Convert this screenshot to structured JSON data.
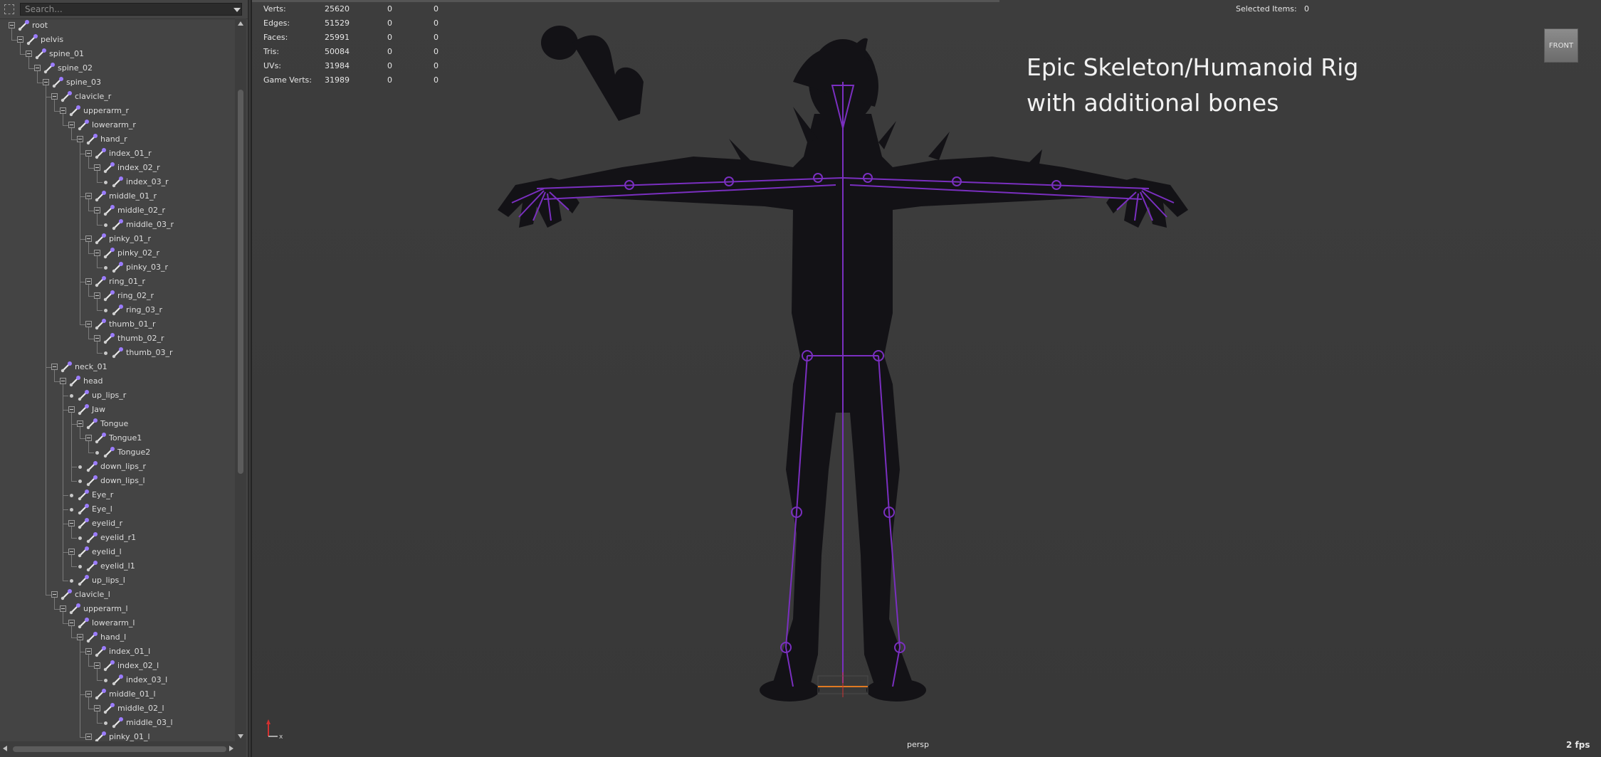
{
  "outliner": {
    "search_placeholder": "Search...",
    "nodes": [
      {
        "label": "root",
        "depth": 0,
        "children": true
      },
      {
        "label": "pelvis",
        "depth": 1,
        "children": true
      },
      {
        "label": "spine_01",
        "depth": 2,
        "children": true
      },
      {
        "label": "spine_02",
        "depth": 3,
        "children": true
      },
      {
        "label": "spine_03",
        "depth": 4,
        "children": true
      },
      {
        "label": "clavicle_r",
        "depth": 5,
        "children": true
      },
      {
        "label": "upperarm_r",
        "depth": 6,
        "children": true
      },
      {
        "label": "lowerarm_r",
        "depth": 7,
        "children": true
      },
      {
        "label": "hand_r",
        "depth": 8,
        "children": true
      },
      {
        "label": "index_01_r",
        "depth": 9,
        "children": true
      },
      {
        "label": "index_02_r",
        "depth": 10,
        "children": true
      },
      {
        "label": "index_03_r",
        "depth": 11,
        "children": false
      },
      {
        "label": "middle_01_r",
        "depth": 9,
        "children": true
      },
      {
        "label": "middle_02_r",
        "depth": 10,
        "children": true
      },
      {
        "label": "middle_03_r",
        "depth": 11,
        "children": false
      },
      {
        "label": "pinky_01_r",
        "depth": 9,
        "children": true
      },
      {
        "label": "pinky_02_r",
        "depth": 10,
        "children": true
      },
      {
        "label": "pinky_03_r",
        "depth": 11,
        "children": false
      },
      {
        "label": "ring_01_r",
        "depth": 9,
        "children": true
      },
      {
        "label": "ring_02_r",
        "depth": 10,
        "children": true
      },
      {
        "label": "ring_03_r",
        "depth": 11,
        "children": false
      },
      {
        "label": "thumb_01_r",
        "depth": 9,
        "children": true
      },
      {
        "label": "thumb_02_r",
        "depth": 10,
        "children": true
      },
      {
        "label": "thumb_03_r",
        "depth": 11,
        "children": false
      },
      {
        "label": "neck_01",
        "depth": 5,
        "children": true
      },
      {
        "label": "head",
        "depth": 6,
        "children": true
      },
      {
        "label": "up_lips_r",
        "depth": 7,
        "children": false
      },
      {
        "label": "Jaw",
        "depth": 7,
        "children": true
      },
      {
        "label": "Tongue",
        "depth": 8,
        "children": true
      },
      {
        "label": "Tongue1",
        "depth": 9,
        "children": true
      },
      {
        "label": "Tongue2",
        "depth": 10,
        "children": false
      },
      {
        "label": "down_lips_r",
        "depth": 8,
        "children": false
      },
      {
        "label": "down_lips_l",
        "depth": 8,
        "children": false
      },
      {
        "label": "Eye_r",
        "depth": 7,
        "children": false
      },
      {
        "label": "Eye_l",
        "depth": 7,
        "children": false
      },
      {
        "label": "eyelid_r",
        "depth": 7,
        "children": true
      },
      {
        "label": "eyelid_r1",
        "depth": 8,
        "children": false
      },
      {
        "label": "eyelid_l",
        "depth": 7,
        "children": true
      },
      {
        "label": "eyelid_l1",
        "depth": 8,
        "children": false
      },
      {
        "label": "up_lips_l",
        "depth": 7,
        "children": false
      },
      {
        "label": "clavicle_l",
        "depth": 5,
        "children": true
      },
      {
        "label": "upperarm_l",
        "depth": 6,
        "children": true
      },
      {
        "label": "lowerarm_l",
        "depth": 7,
        "children": true
      },
      {
        "label": "hand_l",
        "depth": 8,
        "children": true
      },
      {
        "label": "index_01_l",
        "depth": 9,
        "children": true
      },
      {
        "label": "index_02_l",
        "depth": 10,
        "children": true
      },
      {
        "label": "index_03_l",
        "depth": 11,
        "children": false
      },
      {
        "label": "middle_01_l",
        "depth": 9,
        "children": true
      },
      {
        "label": "middle_02_l",
        "depth": 10,
        "children": true
      },
      {
        "label": "middle_03_l",
        "depth": 11,
        "children": false
      },
      {
        "label": "pinky_01_l",
        "depth": 9,
        "children": true
      }
    ]
  },
  "hud": {
    "stats": [
      {
        "label": "Verts:",
        "a": "25620",
        "b": "0",
        "c": "0"
      },
      {
        "label": "Edges:",
        "a": "51529",
        "b": "0",
        "c": "0"
      },
      {
        "label": "Faces:",
        "a": "25991",
        "b": "0",
        "c": "0"
      },
      {
        "label": "Tris:",
        "a": "50084",
        "b": "0",
        "c": "0"
      },
      {
        "label": "UVs:",
        "a": "31984",
        "b": "0",
        "c": "0"
      },
      {
        "label": "Game Verts:",
        "a": "31989",
        "b": "0",
        "c": "0"
      }
    ],
    "selected_label": "Selected Items:",
    "selected_value": "0"
  },
  "viewport": {
    "title_line1": "Epic Skeleton/Humanoid Rig",
    "title_line2": "with additional bones",
    "view_cube": "FRONT",
    "camera": "persp",
    "fps": "2 fps",
    "axis_x": "x"
  },
  "colors": {
    "panel_bg": "#444444",
    "viewport_bg": "#3a3a3a",
    "bone_purple": "#7a2fc0",
    "silhouette": "#131216"
  }
}
